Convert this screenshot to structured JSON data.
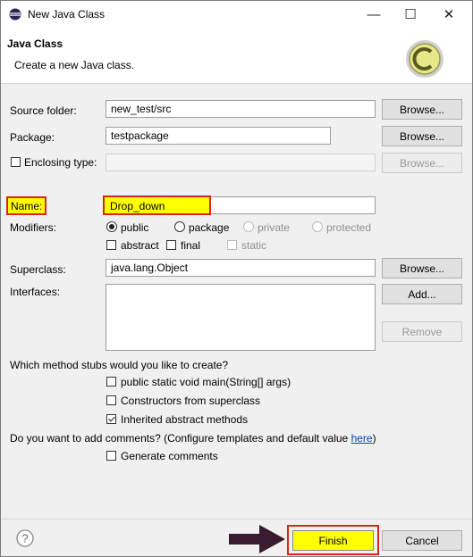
{
  "window": {
    "title": "New Java Class",
    "minimize": "—",
    "maximize": "☐",
    "close": "✕"
  },
  "header": {
    "title": "Java Class",
    "subtitle": "Create a new Java class."
  },
  "source_folder": {
    "label": "Source folder:",
    "value": "new_test/src",
    "browse": "Browse..."
  },
  "package": {
    "label": "Package:",
    "value": "testpackage",
    "browse": "Browse..."
  },
  "enclosing": {
    "label": "Enclosing type:",
    "value": "",
    "browse": "Browse..."
  },
  "name": {
    "label": "Name:",
    "value": "Drop_down"
  },
  "modifiers": {
    "label": "Modifiers:",
    "public": "public",
    "package": "package",
    "private": "private",
    "protected": "protected",
    "abstract": "abstract",
    "final": "final",
    "static": "static"
  },
  "superclass": {
    "label": "Superclass:",
    "value": "java.lang.Object",
    "browse": "Browse..."
  },
  "interfaces": {
    "label": "Interfaces:",
    "add": "Add...",
    "remove": "Remove"
  },
  "stubs": {
    "question": "Which method stubs would you like to create?",
    "main": "public static void main(String[] args)",
    "constructors": "Constructors from superclass",
    "inherited": "Inherited abstract methods"
  },
  "comments": {
    "question": "Do you want to add comments? (Configure templates and default value ",
    "link": "here",
    "close_paren": ")",
    "generate": "Generate comments"
  },
  "footer": {
    "help": "?",
    "finish": "Finish",
    "cancel": "Cancel"
  },
  "colors": {
    "highlight_yellow": "#ffff00",
    "highlight_red": "#d9261c",
    "arrow": "#3a1a2e"
  }
}
